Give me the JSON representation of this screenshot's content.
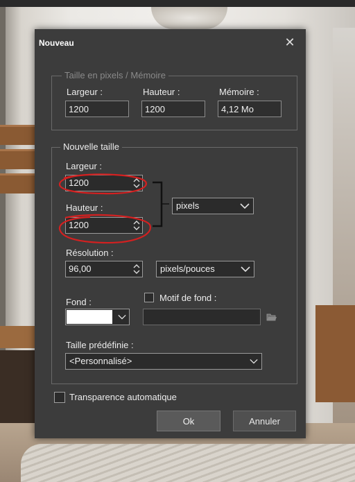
{
  "dialog": {
    "title": "Nouveau",
    "close_glyph": "✕"
  },
  "pixel_size": {
    "legend": "Taille en pixels / Mémoire",
    "width_label": "Largeur :",
    "width_value": "1200",
    "height_label": "Hauteur :",
    "height_value": "1200",
    "memory_label": "Mémoire :",
    "memory_value": "4,12 Mo"
  },
  "new_size": {
    "legend": "Nouvelle taille",
    "width_label": "Largeur :",
    "width_value": "1200",
    "height_label": "Hauteur :",
    "height_value": "1200",
    "unit_value": "pixels",
    "resolution_label": "Résolution :",
    "resolution_value": "96,00",
    "resolution_unit_value": "pixels/pouces",
    "background_label": "Fond :",
    "background_color": "#ffffff",
    "pattern_label": "Motif de fond :",
    "pattern_checked": false,
    "pattern_value": "",
    "preset_label": "Taille prédéfinie :",
    "preset_value": "<Personnalisé>"
  },
  "auto_transparency": {
    "label": "Transparence automatique",
    "checked": false
  },
  "buttons": {
    "ok_label": "Ok",
    "cancel_label": "Annuler"
  },
  "icons": {
    "close": "close-icon",
    "spinner": "spinner-arrows-icon",
    "dropdown": "chevron-down-icon",
    "folder": "folder-open-icon",
    "link": "aspect-link-bracket-icon"
  },
  "colors": {
    "dialog_bg": "#3c3c3c",
    "annotation_red": "#d42020"
  }
}
